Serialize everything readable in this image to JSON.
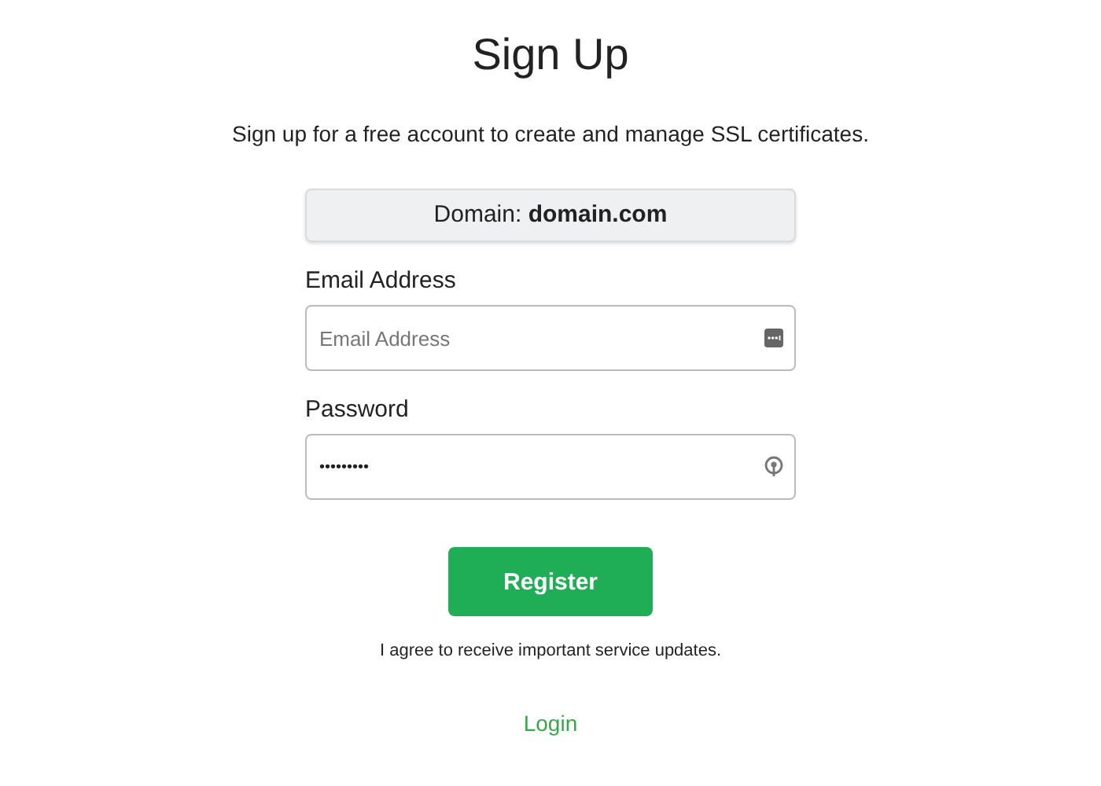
{
  "title": "Sign Up",
  "subtitle": "Sign up for a free account to create and manage SSL certificates.",
  "domain": {
    "label": "Domain: ",
    "value": "domain.com"
  },
  "fields": [
    {
      "label": "Email Address",
      "placeholder": "Email Address",
      "kind": "email"
    },
    {
      "label": "Password",
      "value": "•••••••••",
      "kind": "password"
    }
  ],
  "register_button": "Register",
  "agreement": "I agree to receive important service updates.",
  "login_link": "Login"
}
